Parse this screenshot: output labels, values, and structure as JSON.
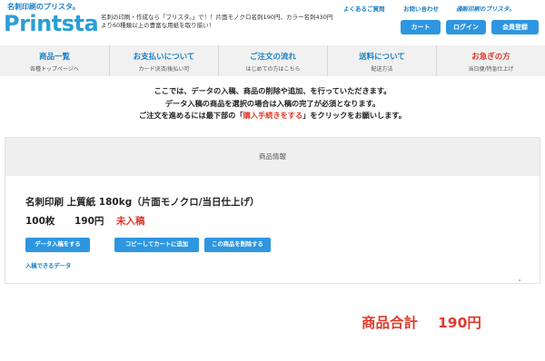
{
  "header": {
    "tagline": "名刺印刷のプリスタ。",
    "logo": "Printsta",
    "intro": "名刺の印刷・作成なら「プリスタ。」で！！片面モノクロ名刺190円、カラー名刺430円より60種類以上の豊富な用紙を取り揃い！",
    "links": {
      "faq": "よくあるご質問",
      "contact": "お問い合わせ",
      "brand": "通販印刷のプリスタ。"
    },
    "buttons": {
      "cart": "カート",
      "login": "ログイン",
      "register": "会員登録"
    }
  },
  "nav": [
    {
      "title": "商品一覧",
      "sub": "各種トップページへ"
    },
    {
      "title": "お支払いについて",
      "sub": "カード決済/後払い可"
    },
    {
      "title": "ご注文の流れ",
      "sub": "はじめての方はこちら"
    },
    {
      "title": "送料について",
      "sub": "配送方法"
    },
    {
      "title": "お急ぎの方",
      "sub": "当日便/特急仕上げ"
    }
  ],
  "notice": {
    "line1": "ここでは、データの入稿、商品の削除や追加、を行っていただきます。",
    "line2": "データ入稿の商品を選択の場合は入稿の完了が必須となります。",
    "line3_pre": "ご注文を進めるには最下部の「",
    "line3_hl": "購入手続きをする",
    "line3_post": "」をクリックをお願いします。"
  },
  "panel": {
    "heading": "商品情報",
    "product": {
      "title": "名刺印刷 上質紙 180kg（片面モノクロ/当日仕上げ）",
      "quantity": "100枚",
      "price": "190円",
      "status": "未入稿"
    },
    "actions": {
      "upload": "データ入稿をする",
      "copy": "コピーしてカートに追加",
      "delete": "この商品を削除する"
    },
    "data_link": "入稿できるデータ"
  },
  "total": {
    "label": "商品合計",
    "value": "190円"
  },
  "colors": {
    "accent": "#2e96e0",
    "link": "#1a7fc4",
    "alert": "#e03a2c",
    "nav_bg": "#f1f1f1"
  }
}
